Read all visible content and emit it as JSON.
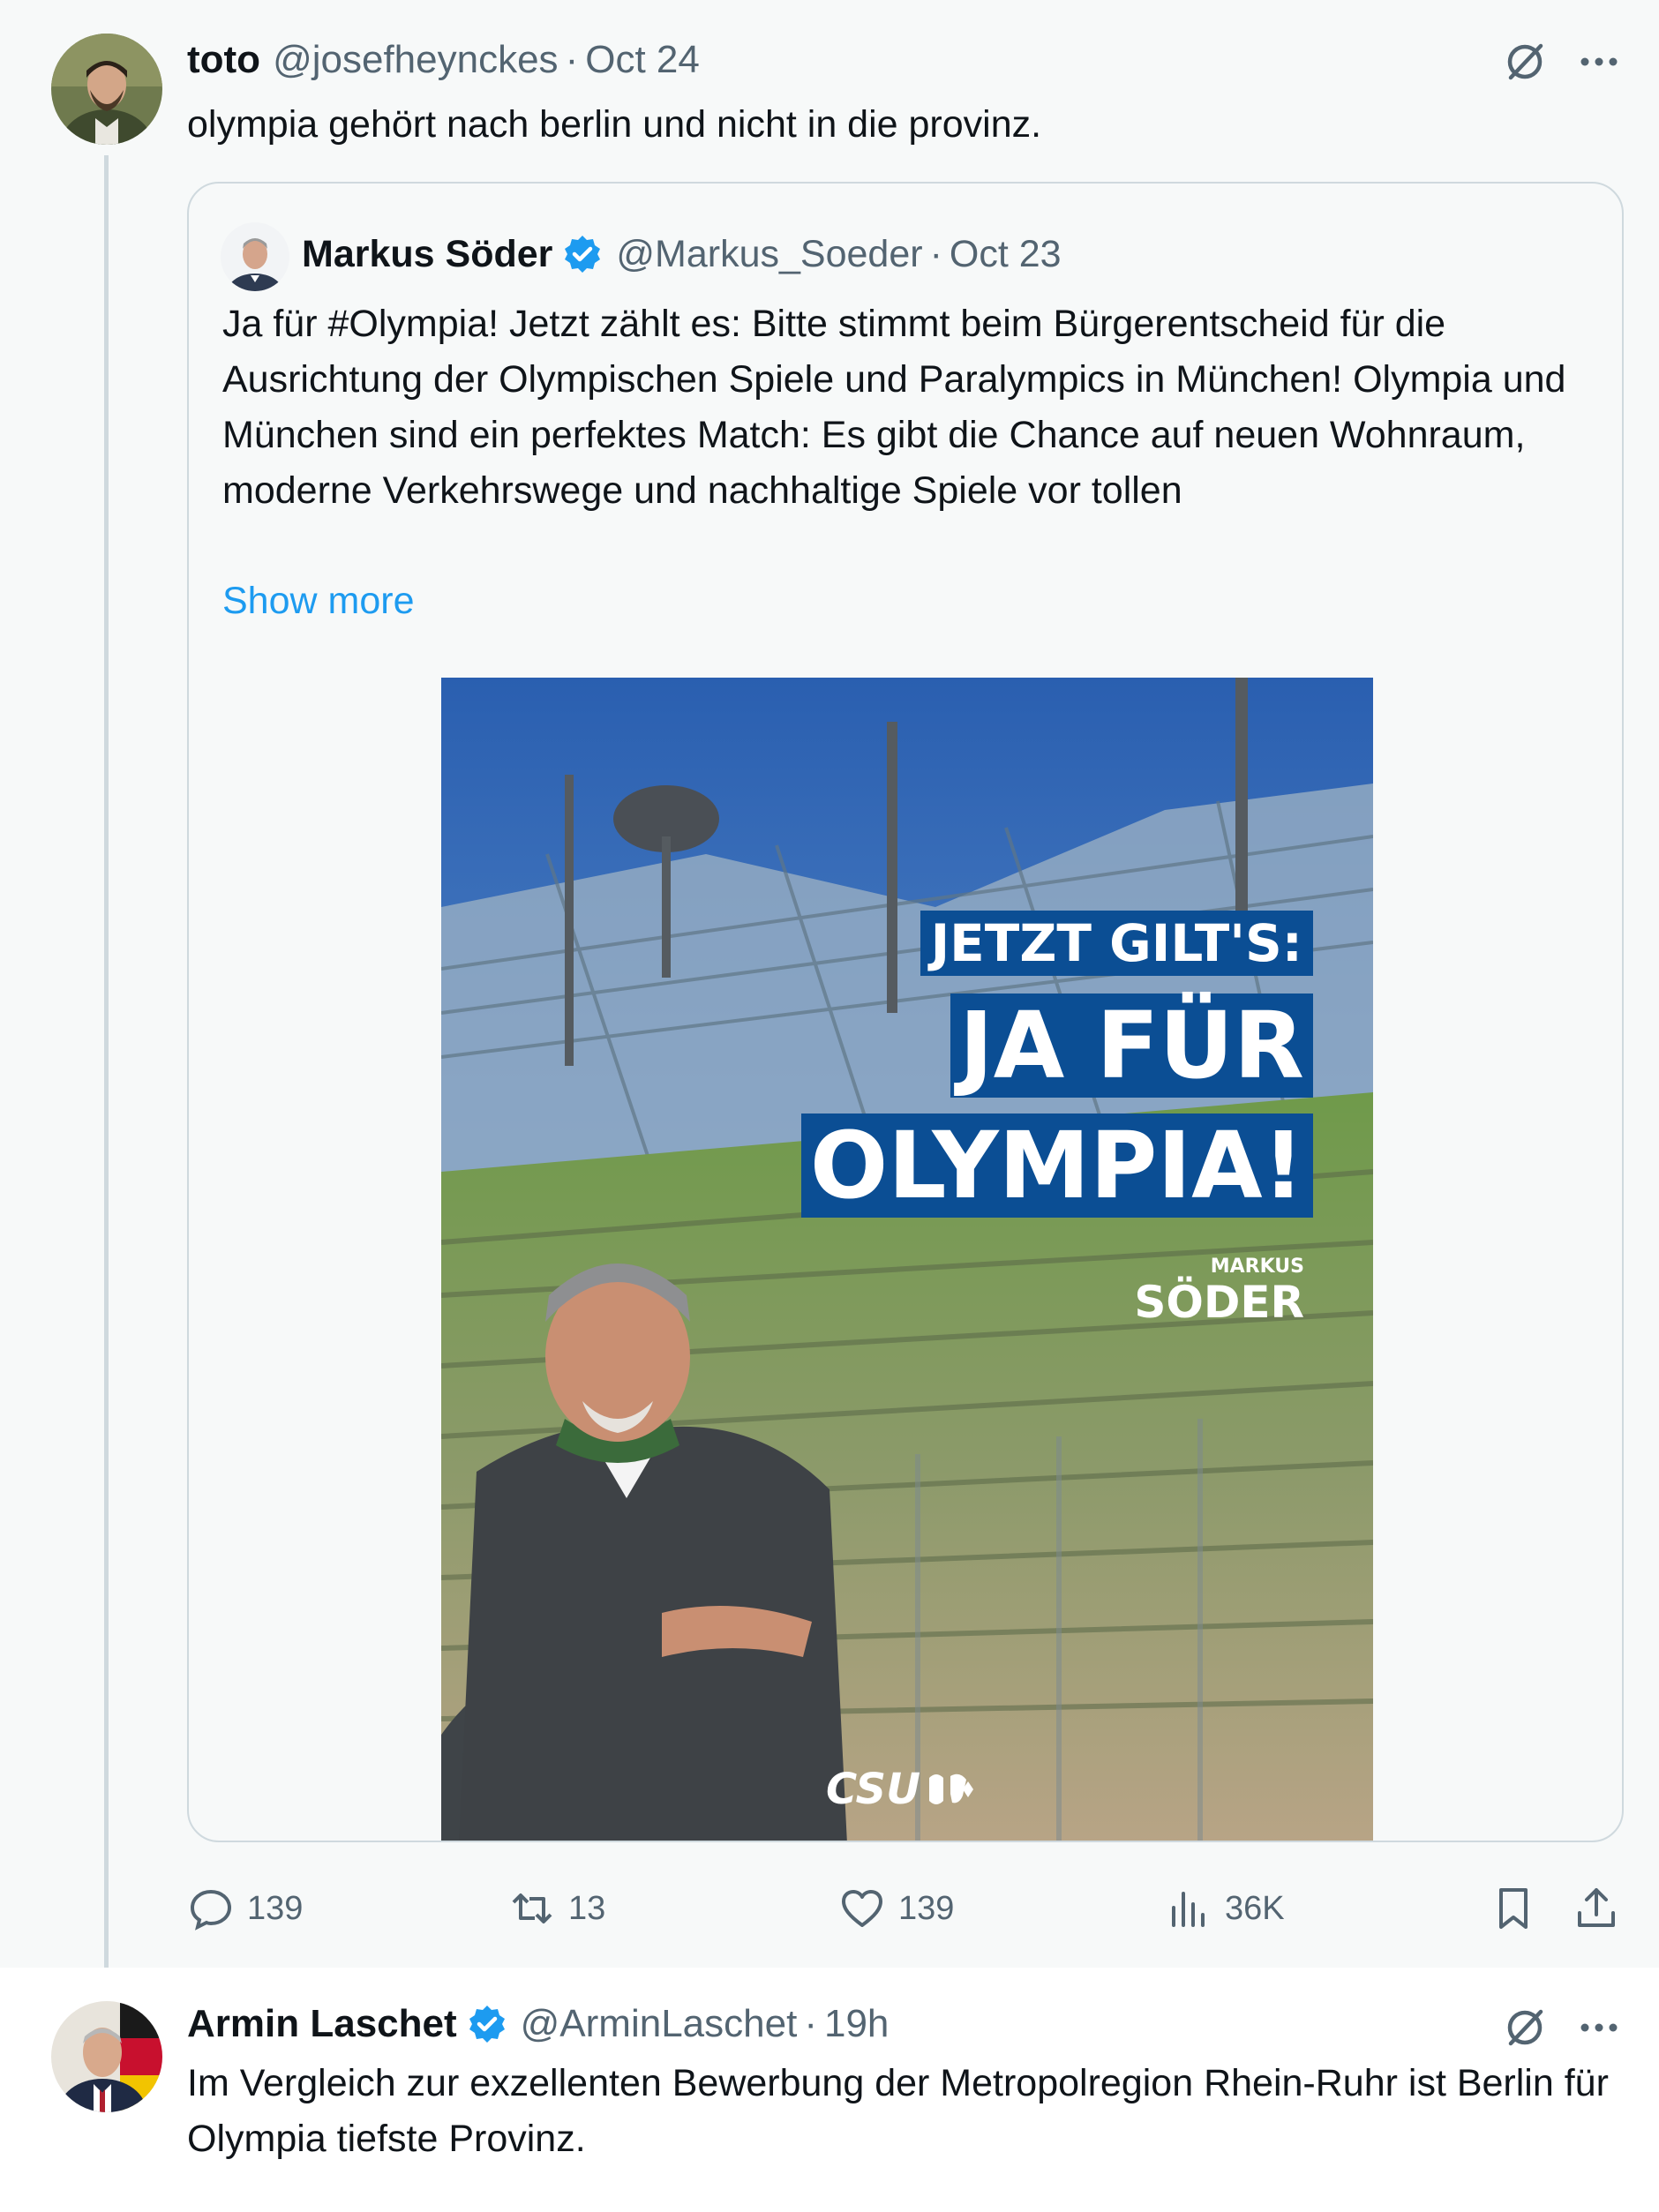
{
  "tweets": [
    {
      "name": "toto",
      "handle": "@josefheynckes",
      "separator": "·",
      "time": "Oct 24",
      "text": "olympia gehört nach berlin und nicht in die provinz.",
      "quote": {
        "name": "Markus Söder",
        "handle": "@Markus_Soeder",
        "separator": "·",
        "time": "Oct 23",
        "text": "Ja für #Olympia! Jetzt zählt es: Bitte stimmt beim Bürgerentscheid für die Ausrichtung der Olympischen Spiele und Paralympics in München! Olympia und München sind ein perfektes Match: Es gibt die Chance auf neuen Wohnraum, moderne Verkehrswege und nachhaltige Spiele vor tollen",
        "show_more": "Show more",
        "poster": {
          "line1": "JETZT GILT'S:",
          "line2": "JA FÜR",
          "line3": "OLYMPIA!",
          "signature_small": "MARKUS",
          "signature_big": "SÖDER",
          "logo_text": "CSU"
        }
      },
      "actions": {
        "replies": "139",
        "reposts": "13",
        "likes": "139",
        "views": "36K"
      }
    },
    {
      "name": "Armin Laschet",
      "handle": "@ArminLaschet",
      "separator": "·",
      "time": "19h",
      "text": "Im Vergleich zur exzellenten Bewerbung der Metropolregion Rhein-Ruhr ist Berlin für Olympia tiefste Provinz."
    }
  ],
  "colors": {
    "text_primary": "#0f1419",
    "text_secondary": "#536471",
    "link": "#1d9bf0",
    "verified": "#1d9bf0",
    "thread_line": "#cfd9de",
    "poster_banner": "#0b4e94"
  },
  "icons": [
    "grok-icon",
    "more-icon",
    "verified-badge-icon",
    "reply-icon",
    "repost-icon",
    "like-icon",
    "views-icon",
    "bookmark-icon",
    "share-icon"
  ]
}
